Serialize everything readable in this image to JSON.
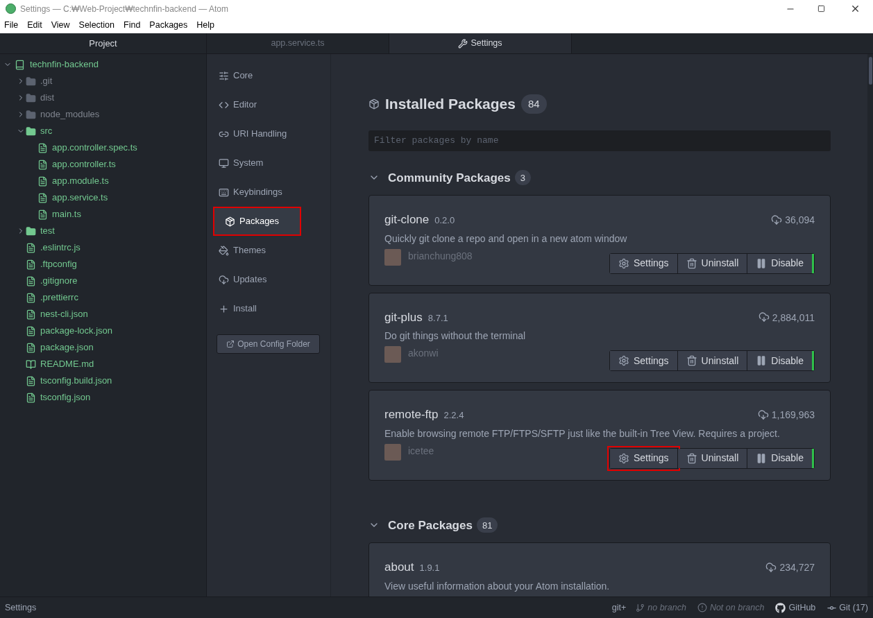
{
  "window": {
    "title": "Settings — C:₩Web-Project₩technfin-backend — Atom"
  },
  "menu": [
    "File",
    "Edit",
    "View",
    "Selection",
    "Find",
    "Packages",
    "Help"
  ],
  "tree": {
    "title": "Project",
    "root": {
      "name": "technfin-backend",
      "expanded": true,
      "children": [
        {
          "kind": "folder",
          "name": ".git",
          "expanded": false,
          "ignored": true
        },
        {
          "kind": "folder",
          "name": "dist",
          "expanded": false,
          "ignored": true
        },
        {
          "kind": "folder",
          "name": "node_modules",
          "expanded": false,
          "ignored": true
        },
        {
          "kind": "folder",
          "name": "src",
          "expanded": true,
          "ignored": false,
          "children": [
            {
              "kind": "file",
              "name": "app.controller.spec.ts",
              "ignored": false
            },
            {
              "kind": "file",
              "name": "app.controller.ts",
              "ignored": false
            },
            {
              "kind": "file",
              "name": "app.module.ts",
              "ignored": false
            },
            {
              "kind": "file",
              "name": "app.service.ts",
              "ignored": false
            },
            {
              "kind": "file",
              "name": "main.ts",
              "ignored": false
            }
          ]
        },
        {
          "kind": "folder",
          "name": "test",
          "expanded": false,
          "ignored": false
        },
        {
          "kind": "file",
          "name": ".eslintrc.js",
          "ignored": false
        },
        {
          "kind": "file",
          "name": ".ftpconfig",
          "ignored": false
        },
        {
          "kind": "file",
          "name": ".gitignore",
          "ignored": false
        },
        {
          "kind": "file",
          "name": ".prettierrc",
          "ignored": false
        },
        {
          "kind": "file",
          "name": "nest-cli.json",
          "ignored": false
        },
        {
          "kind": "file",
          "name": "package-lock.json",
          "ignored": false
        },
        {
          "kind": "file",
          "name": "package.json",
          "ignored": false
        },
        {
          "kind": "readme",
          "name": "README.md",
          "ignored": false
        },
        {
          "kind": "file",
          "name": "tsconfig.build.json",
          "ignored": false
        },
        {
          "kind": "file",
          "name": "tsconfig.json",
          "ignored": false
        }
      ]
    }
  },
  "tabs": [
    {
      "label": "app.service.ts",
      "selected": false
    },
    {
      "label": "Settings",
      "selected": true
    }
  ],
  "settings_nav": {
    "items": [
      {
        "label": "Core",
        "selected": false,
        "highlighted": false
      },
      {
        "label": "Editor",
        "selected": false,
        "highlighted": false
      },
      {
        "label": "URI Handling",
        "selected": false,
        "highlighted": false
      },
      {
        "label": "System",
        "selected": false,
        "highlighted": false
      },
      {
        "label": "Keybindings",
        "selected": false,
        "highlighted": false
      },
      {
        "label": "Packages",
        "selected": true,
        "highlighted": true
      },
      {
        "label": "Themes",
        "selected": false,
        "highlighted": false
      },
      {
        "label": "Updates",
        "selected": false,
        "highlighted": false
      },
      {
        "label": "Install",
        "selected": false,
        "highlighted": false
      }
    ],
    "button": "Open Config Folder"
  },
  "installed": {
    "title": "Installed Packages",
    "count": "84",
    "filter": {
      "placeholder": "Filter packages by name"
    },
    "sections": [
      {
        "title": "Community Packages",
        "count": "3",
        "expanded": true,
        "packages": [
          {
            "name": "git-clone",
            "version": "0.2.0",
            "downloads": "36,094",
            "description": "Quickly git clone a repo and open in a new atom window",
            "author": "brianchung808",
            "buttons": [
              {
                "label": "Settings",
                "highlighted": false
              },
              {
                "label": "Uninstall",
                "highlighted": false
              },
              {
                "label": "Disable",
                "highlighted": false
              }
            ]
          },
          {
            "name": "git-plus",
            "version": "8.7.1",
            "downloads": "2,884,011",
            "description": "Do git things without the terminal",
            "author": "akonwi",
            "buttons": [
              {
                "label": "Settings",
                "highlighted": false
              },
              {
                "label": "Uninstall",
                "highlighted": false
              },
              {
                "label": "Disable",
                "highlighted": false
              }
            ]
          },
          {
            "name": "remote-ftp",
            "version": "2.2.4",
            "downloads": "1,169,963",
            "description": "Enable browsing remote FTP/FTPS/SFTP just like the built-in Tree View. Requires a project.",
            "author": "icetee",
            "buttons": [
              {
                "label": "Settings",
                "highlighted": true
              },
              {
                "label": "Uninstall",
                "highlighted": false
              },
              {
                "label": "Disable",
                "highlighted": false
              }
            ]
          }
        ]
      },
      {
        "title": "Core Packages",
        "count": "81",
        "expanded": true,
        "packages": [
          {
            "name": "about",
            "version": "1.9.1",
            "downloads": "234,727",
            "description": "View useful information about your Atom installation."
          }
        ]
      }
    ]
  },
  "status_bar": {
    "left": "Settings",
    "git_plus": "git+",
    "branch": "no branch",
    "warning": "Not on branch",
    "github": "GitHub",
    "git": "Git (17)"
  }
}
